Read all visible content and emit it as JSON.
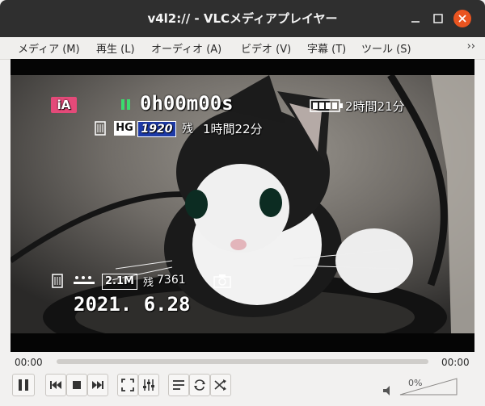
{
  "window": {
    "title": "v4l2:// - VLCメディアプレイヤー"
  },
  "menu": {
    "items": [
      {
        "label": "メディア (M)"
      },
      {
        "label": "再生 (L)"
      },
      {
        "label": "オーディオ (A)"
      },
      {
        "label": "ビデオ (V)"
      },
      {
        "label": "字幕 (T)"
      },
      {
        "label": "ツール (S)"
      }
    ],
    "overflow": "››"
  },
  "video": {
    "osd": {
      "mode_badge": "iA",
      "timecode": "0h00m00s",
      "battery_time": "2時間21分",
      "hg_label": "HG",
      "resolution": "1920",
      "remaining_label": "残",
      "remaining_time": "1時間22分",
      "photo_size": "2.1M",
      "photo_remaining_label": "残",
      "photo_remaining": "7361",
      "date": "2021. 6.28"
    }
  },
  "controls": {
    "elapsed": "00:00",
    "total": "00:00",
    "volume": "0%",
    "progress": 0,
    "accent_color": "#e95420"
  }
}
